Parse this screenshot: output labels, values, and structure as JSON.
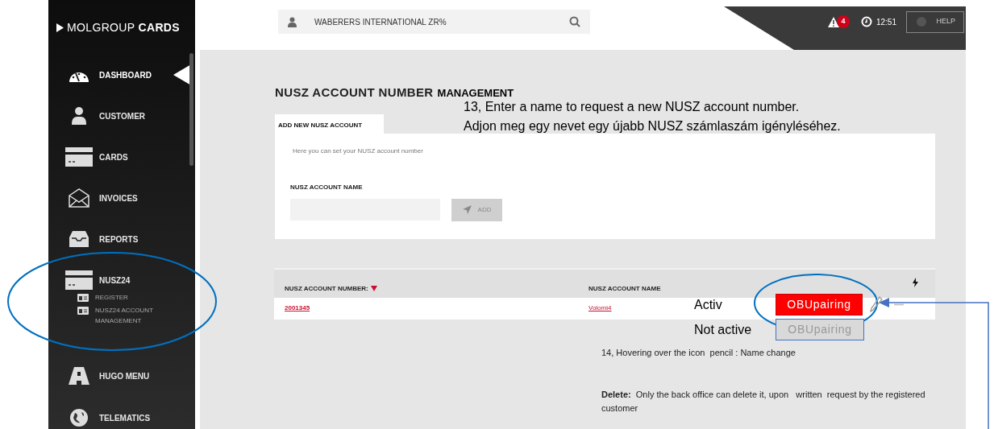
{
  "brand": {
    "prefix": "MOLGROUP",
    "name": "CARDS"
  },
  "search": {
    "value": "WABERERS INTERNATIONAL ZR%"
  },
  "alerts": {
    "count": "4"
  },
  "clock": "12:51",
  "help": "HELP",
  "sidebar": {
    "items": [
      {
        "label": "DASHBOARD",
        "kind": "gauge",
        "selected": true
      },
      {
        "label": "CUSTOMER",
        "kind": "person",
        "selected": false
      },
      {
        "label": "CARDS",
        "kind": "card",
        "selected": false
      },
      {
        "label": "INVOICES",
        "kind": "envelope",
        "selected": false
      },
      {
        "label": "REPORTS",
        "kind": "tray",
        "selected": false
      },
      {
        "label": "NUSZ24",
        "kind": "card",
        "selected": false,
        "children": [
          {
            "label": "REGISTER"
          },
          {
            "label": "NUSZ24 ACCOUNT MANAGEMENT"
          }
        ]
      },
      {
        "label": "HUGO MENU",
        "kind": "road",
        "selected": false
      },
      {
        "label": "TELEMATICS",
        "kind": "globe",
        "selected": false
      }
    ]
  },
  "page": {
    "title": "NUSZ ACCOUNT NUMBER",
    "title_suffix": "MANAGEMENT",
    "form": {
      "tab": "ADD NEW NUSZ ACCOUNT",
      "hint": "Here you can set your NUSZ account number",
      "field_label": "NUSZ ACCOUNT NAME",
      "button": "ADD"
    },
    "table": {
      "columns": [
        {
          "label": "NUSZ ACCOUNT NUMBER:",
          "sorted": true
        },
        {
          "label": "NUSZ ACCOUNT NAME"
        },
        {
          "kind": "bolt"
        }
      ],
      "rows": [
        {
          "number": "2001345",
          "name": "Volomi4"
        }
      ]
    }
  },
  "annotations": {
    "step_13": [
      "13, Enter a name to request a new NUSZ account number.",
      "Adjon meg egy nevet egy újabb NUSZ számlaszám igényléséhez."
    ],
    "obu_states": [
      {
        "label": "Activ",
        "button": "OBUpairing",
        "active": true
      },
      {
        "label": "Not active",
        "button": "OBUpairing",
        "active": false
      }
    ],
    "step_14": "14, Hovering over the icon  pencil : Name change",
    "delete_note": "**Delete:**  Only the back office can delete it, upon   written  request by the registered customer"
  }
}
